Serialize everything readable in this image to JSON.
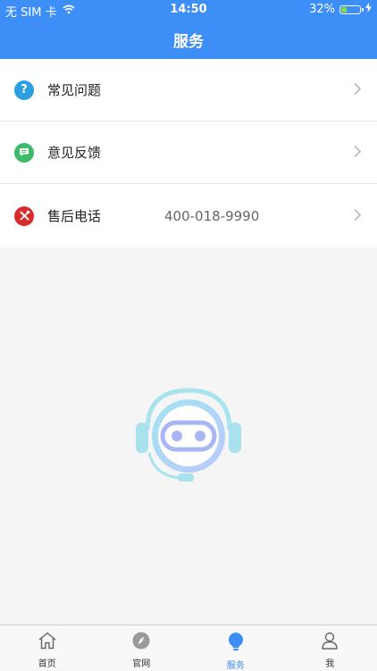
{
  "status_bar": {
    "carrier": "无 SIM 卡",
    "time": "14:50",
    "battery": "32%",
    "battery_level": 0.32
  },
  "navbar": {
    "title": "服务"
  },
  "rows": [
    {
      "label": "常见问题",
      "icon": "question-icon",
      "color": "#2b9fe0",
      "value": ""
    },
    {
      "label": "意见反馈",
      "icon": "feedback-icon",
      "color": "#3dbb6b",
      "value": ""
    },
    {
      "label": "售后电话",
      "icon": "tools-icon",
      "color": "#d92b2b",
      "value": "400-018-9990"
    }
  ],
  "tabs": [
    {
      "label": "首页",
      "icon": "home-icon",
      "active": false
    },
    {
      "label": "官网",
      "icon": "compass-icon",
      "active": false
    },
    {
      "label": "服务",
      "icon": "bulb-icon",
      "active": true
    },
    {
      "label": "我",
      "icon": "person-icon",
      "active": false
    }
  ],
  "colors": {
    "accent": "#3e8ef7"
  }
}
